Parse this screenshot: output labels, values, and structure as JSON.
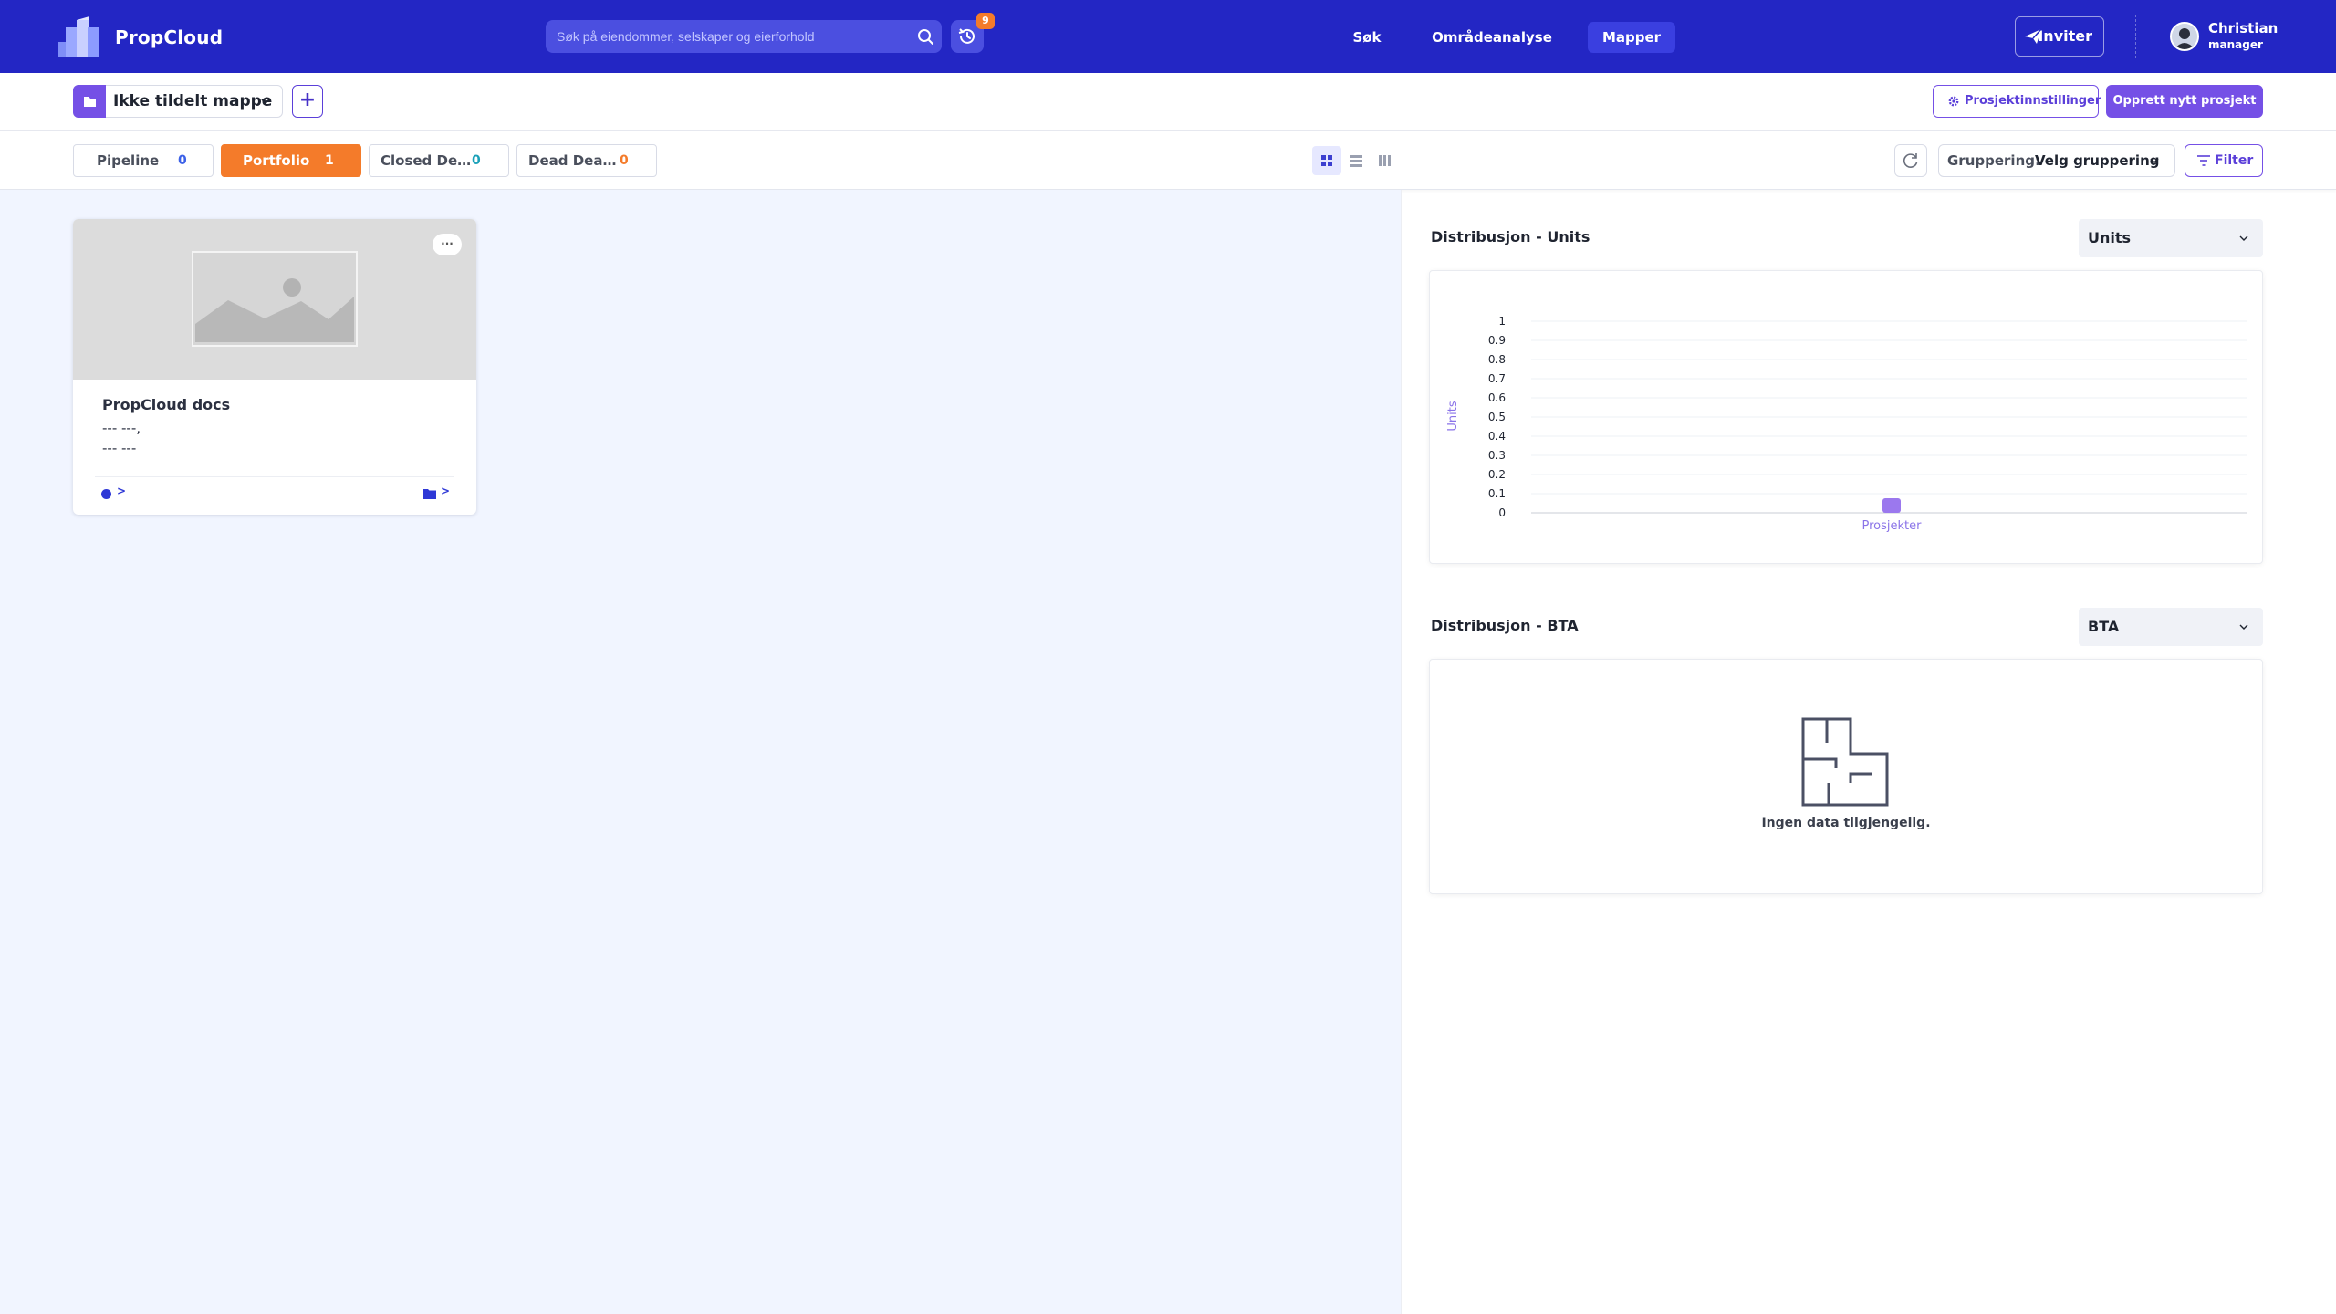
{
  "header": {
    "brand": "PropCloud",
    "search_placeholder": "Søk på eiendommer, selskaper og eierforhold",
    "history_badge": "9",
    "nav": [
      {
        "label": "Søk"
      },
      {
        "label": "Områdeanalyse"
      },
      {
        "label": "Mapper",
        "active": true
      }
    ],
    "invite_label": "Inviter",
    "user": {
      "name": "Christian",
      "role": "manager"
    },
    "colors": {
      "bar": "#2326c4",
      "accent": "#7550e6",
      "badge": "#f47b2a"
    }
  },
  "folderbar": {
    "folder_name": "Ikke tildelt mappe",
    "add_label": "+",
    "settings_label": "Prosjektinnstillinger",
    "new_project_label": "Opprett nytt prosjekt"
  },
  "tabs": [
    {
      "label": "Pipeline",
      "count": "0"
    },
    {
      "label": "Portfolio",
      "count": "1",
      "active": true
    },
    {
      "label": "Closed De…",
      "count": "0"
    },
    {
      "label": "Dead Dea…",
      "count": "0"
    }
  ],
  "toolbar": {
    "view_modes": [
      "grid-view-icon",
      "list-view-icon",
      "columns-view-icon"
    ],
    "active_view": "grid",
    "grouping_label": "Gruppering:",
    "grouping_value": "Velg gruppering",
    "filter_label": "Filter"
  },
  "cards": [
    {
      "title": "PropCloud docs",
      "line1": "--- ---,",
      "line2": "--- ---",
      "menu": "···",
      "arrow": ">"
    }
  ],
  "panels": {
    "units": {
      "title": "Distribusjon - Units",
      "dropdown": "Units"
    },
    "bta": {
      "title": "Distribusjon - BTA",
      "dropdown": "BTA",
      "empty_text": "Ingen data tilgjengelig."
    }
  },
  "chart_data": {
    "type": "bar",
    "categories": [
      "Prosjekter"
    ],
    "values": [
      0
    ],
    "ylabel": "Units",
    "xlabel": "",
    "ylim": [
      0,
      1
    ],
    "yticks": [
      "1",
      "0.9",
      "0.8",
      "0.7",
      "0.6",
      "0.5",
      "0.4",
      "0.3",
      "0.2",
      "0.1",
      "0"
    ],
    "grid": true,
    "color": "#9b78ee"
  }
}
